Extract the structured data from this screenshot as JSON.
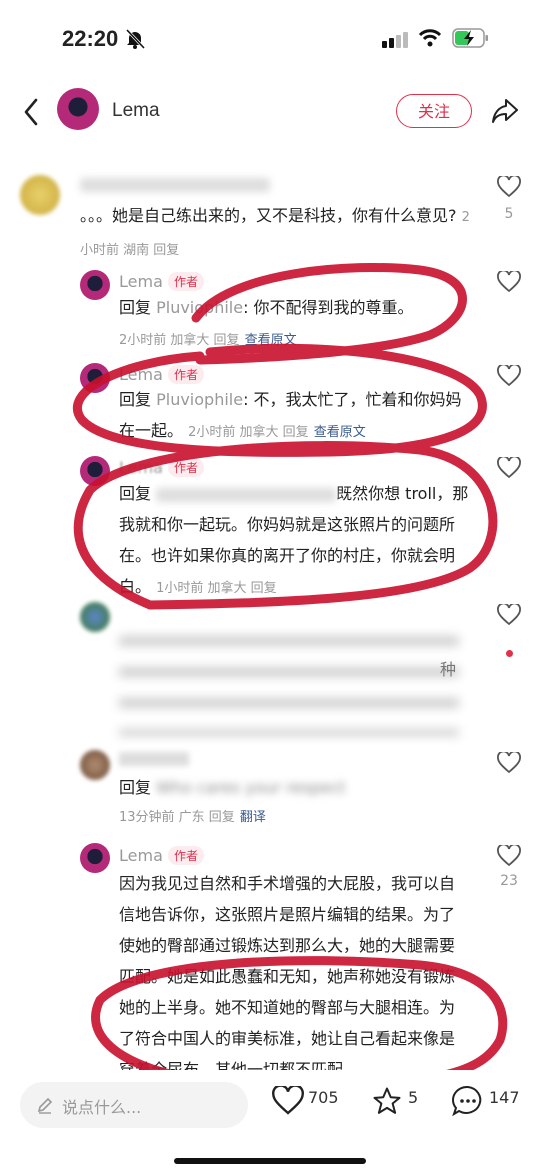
{
  "status": {
    "time": "22:20"
  },
  "header": {
    "name": "Lema",
    "follow_label": "关注"
  },
  "comments": [
    {
      "user": "",
      "text": "。。。她是自己练出来的，又不是科技，你有什么意见?",
      "meta": "2小时前 湖南 回复",
      "likes": "5"
    },
    {
      "user": "Lema",
      "tag": "作者",
      "reply_prefix": "回复 ",
      "reply_to": "Pluviophile",
      "text": ": 你不配得到我的尊重。",
      "meta": "2小时前 加拿大 回复",
      "link": "查看原文"
    },
    {
      "user": "Lema",
      "tag": "作者",
      "reply_prefix": "回复 ",
      "reply_to": "Pluviophile",
      "text": ": 不，我太忙了，忙着和你妈妈在一起。",
      "meta": "2小时前 加拿大 回复",
      "link": "查看原文"
    },
    {
      "user": "Lema",
      "tag": "作者",
      "reply_prefix": "回复 ",
      "text": "既然你想 troll，那我就和你一起玩。你妈妈就是这张照片的问题所在。也许如果你真的离开了你的村庄，你就会明白。",
      "meta": "1小时前 加拿大 回复"
    },
    {
      "user": "",
      "text": "种"
    },
    {
      "user": "",
      "reply_prefix": "回复 ",
      "text": "Who cares your respect",
      "meta": "13分钟前 广东 回复",
      "link": "翻译"
    },
    {
      "user": "Lema",
      "tag": "作者",
      "text": "因为我见过自然和手术增强的大屁股，我可以自信地告诉你，这张照片是照片编辑的结果。为了使她的臀部通过锻炼达到那么大，她的大腿需要匹配。她是如此愚蠢和无知，她声称她没有锻炼她的上半身。她不知道她的臀部与大腿相连。为了符合中国人的审美标准，她让自己看起来像是穿着全尿布。其他一切都不匹配",
      "likes": "23"
    }
  ],
  "bottom": {
    "input_placeholder": "说点什么...",
    "likes": "705",
    "favorites": "5",
    "comments": "147"
  },
  "colors": {
    "accent": "#e0304a",
    "annotation": "#c8102e",
    "link": "#3b5b8f"
  }
}
